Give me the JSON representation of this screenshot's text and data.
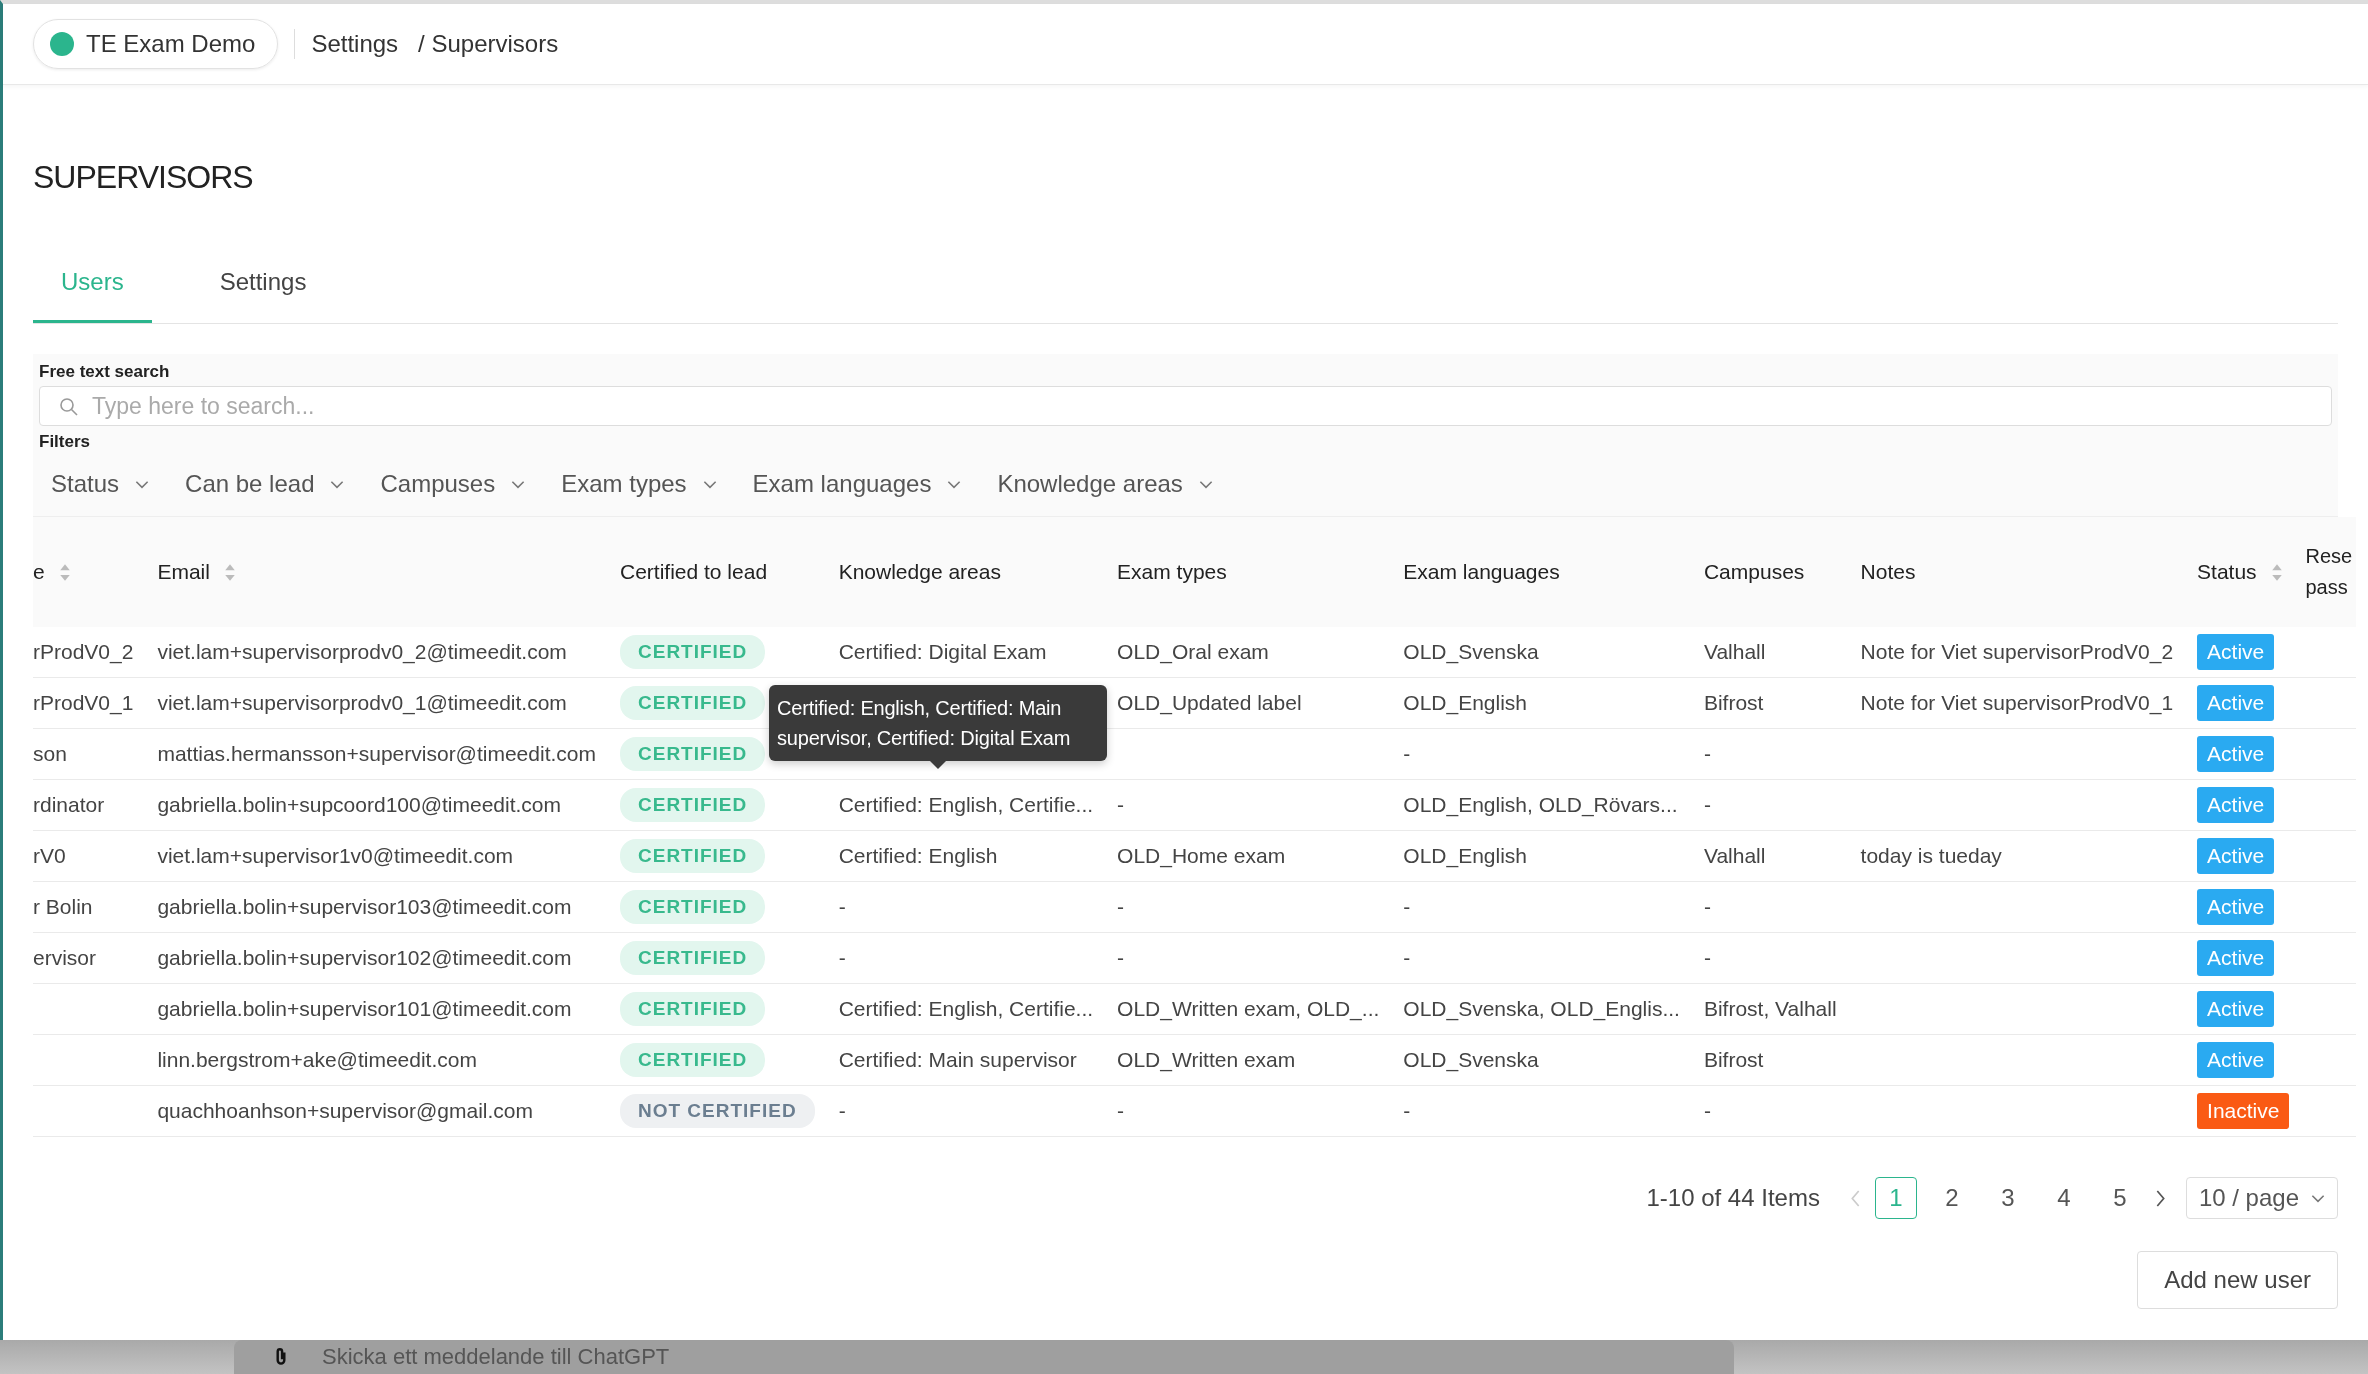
{
  "header": {
    "app_name": "TE Exam Demo",
    "breadcrumb": [
      "Settings",
      "/ Supervisors"
    ]
  },
  "page_title": "SUPERVISORS",
  "tabs": [
    {
      "label": "Users",
      "selected": true
    },
    {
      "label": "Settings",
      "selected": false
    }
  ],
  "search": {
    "label": "Free text search",
    "placeholder": "Type here to search..."
  },
  "filters": {
    "label": "Filters",
    "items": [
      "Status",
      "Can be lead",
      "Campuses",
      "Exam types",
      "Exam languages",
      "Knowledge areas"
    ]
  },
  "table": {
    "columns": [
      {
        "label": "e",
        "sortable": true
      },
      {
        "label": "Email",
        "sortable": true
      },
      {
        "label": "Certified to lead",
        "sortable": false
      },
      {
        "label": "Knowledge areas",
        "sortable": false
      },
      {
        "label": "Exam types",
        "sortable": false
      },
      {
        "label": "Exam languages",
        "sortable": false
      },
      {
        "label": "Campuses",
        "sortable": false
      },
      {
        "label": "Notes",
        "sortable": false
      },
      {
        "label": "Status",
        "sortable": true
      },
      {
        "label": "Rese pass",
        "sortable": false
      }
    ],
    "rows": [
      {
        "column_1": "rProdV0_2",
        "email": "viet.lam+supervisorprodv0_2@timeedit.com",
        "certified_to_lead": {
          "label": "CERTIFIED",
          "certified": true
        },
        "knowledge_areas": "Certified: Digital Exam",
        "exam_types": "OLD_Oral exam",
        "exam_languages": "OLD_Svenska",
        "campuses": "Valhall",
        "notes": "Note for Viet supervisorProdV0_2",
        "status": {
          "label": "Active",
          "active": true
        }
      },
      {
        "column_1": "rProdV0_1",
        "email": "viet.lam+supervisorprodv0_1@timeedit.com",
        "certified_to_lead": {
          "label": "CERTIFIED",
          "certified": true
        },
        "exam_types": "OLD_Updated label",
        "exam_languages": "OLD_English",
        "campuses": "Bifrost",
        "notes": "Note for Viet supervisorProdV0_1",
        "status": {
          "label": "Active",
          "active": true
        }
      },
      {
        "column_1": "son",
        "email": "mattias.hermansson+supervisor@timeedit.com",
        "certified_to_lead": {
          "label": "CERTIFIED",
          "certified": true
        },
        "exam_languages": "-",
        "campuses": "-",
        "status": {
          "label": "Active",
          "active": true
        }
      },
      {
        "column_1": "rdinator",
        "email": "gabriella.bolin+supcoord100@timeedit.com",
        "certified_to_lead": {
          "label": "CERTIFIED",
          "certified": true
        },
        "knowledge_areas": "Certified: English, Certifie...",
        "exam_types": "-",
        "exam_languages": "OLD_English, OLD_Rövars...",
        "campuses": "-",
        "status": {
          "label": "Active",
          "active": true
        }
      },
      {
        "column_1": "rV0",
        "email": "viet.lam+supervisor1v0@timeedit.com",
        "certified_to_lead": {
          "label": "CERTIFIED",
          "certified": true
        },
        "knowledge_areas": "Certified: English",
        "exam_types": "OLD_Home exam",
        "exam_languages": "OLD_English",
        "campuses": "Valhall",
        "notes": "today is tueday",
        "status": {
          "label": "Active",
          "active": true
        }
      },
      {
        "column_1": "r Bolin",
        "email": "gabriella.bolin+supervisor103@timeedit.com",
        "certified_to_lead": {
          "label": "CERTIFIED",
          "certified": true
        },
        "knowledge_areas": "-",
        "exam_types": "-",
        "exam_languages": "-",
        "campuses": "-",
        "status": {
          "label": "Active",
          "active": true
        }
      },
      {
        "column_1": "ervisor",
        "email": "gabriella.bolin+supervisor102@timeedit.com",
        "certified_to_lead": {
          "label": "CERTIFIED",
          "certified": true
        },
        "knowledge_areas": "-",
        "exam_types": "-",
        "exam_languages": "-",
        "campuses": "-",
        "status": {
          "label": "Active",
          "active": true
        }
      },
      {
        "email": "gabriella.bolin+supervisor101@timeedit.com",
        "certified_to_lead": {
          "label": "CERTIFIED",
          "certified": true
        },
        "knowledge_areas": "Certified: English, Certifie...",
        "exam_types": "OLD_Written exam, OLD_...",
        "exam_languages": "OLD_Svenska, OLD_Englis...",
        "campuses": "Bifrost, Valhall",
        "status": {
          "label": "Active",
          "active": true
        }
      },
      {
        "email": "linn.bergstrom+ake@timeedit.com",
        "certified_to_lead": {
          "label": "CERTIFIED",
          "certified": true
        },
        "knowledge_areas": "Certified: Main supervisor",
        "exam_types": "OLD_Written exam",
        "exam_languages": "OLD_Svenska",
        "campuses": "Bifrost",
        "status": {
          "label": "Active",
          "active": true
        }
      },
      {
        "email": "quachhoanhson+supervisor@gmail.com",
        "certified_to_lead": {
          "label": "NOT CERTIFIED",
          "certified": false
        },
        "knowledge_areas": "-",
        "exam_types": "-",
        "exam_languages": "-",
        "campuses": "-",
        "status": {
          "label": "Inactive",
          "active": false
        }
      }
    ]
  },
  "tooltip": "Certified: English, Certified: Main supervisor, Certified: Digital Exam",
  "pagination": {
    "summary": "1-10 of 44 Items",
    "prev": {
      "disabled": true
    },
    "pages": [
      {
        "label": "1",
        "selected": true
      },
      {
        "label": "2",
        "selected": false
      },
      {
        "label": "3",
        "selected": false
      },
      {
        "label": "4",
        "selected": false
      },
      {
        "label": "5",
        "selected": false
      }
    ],
    "next": {
      "disabled": false
    },
    "page_size": "10 / page"
  },
  "add_button": "Add new user",
  "bottom_bar": {
    "placeholder": "Skicka ett meddelande till ChatGPT"
  }
}
